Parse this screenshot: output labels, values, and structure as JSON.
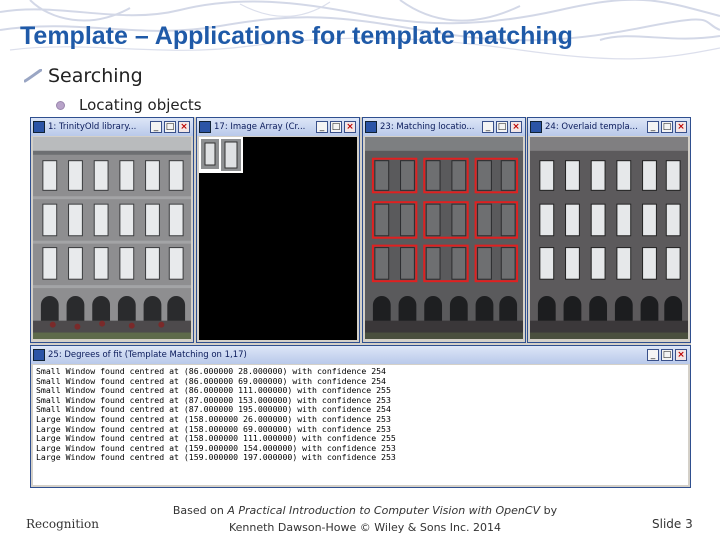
{
  "slide": {
    "title": "Template – Applications for template matching",
    "bullet_level1": "Searching",
    "bullet_level2": "Locating objects"
  },
  "windows": [
    {
      "title": "1: TrinityOld library...",
      "content": "original-image"
    },
    {
      "title": "17: Image Array (Cr...",
      "content": "template-array"
    },
    {
      "title": "23: Matching locatio...",
      "content": "matching-locations"
    },
    {
      "title": "24: Overlaid templa...",
      "content": "overlaid-templates"
    }
  ],
  "window_buttons": {
    "minimize": "_",
    "maximize": "□",
    "close": "×"
  },
  "output_window": {
    "title": "25: Degrees of fit (Template Matching on 1,17)",
    "lines": [
      "Small Window found centred at (86.000000 28.000000) with confidence 254",
      "Small Window found centred at (86.000000 69.000000) with confidence 254",
      "Small Window found centred at (86.000000 111.000000) with confidence 255",
      "Small Window found centred at (87.000000 153.000000) with confidence 253",
      "Small Window found centred at (87.000000 195.000000) with confidence 254",
      "Large Window found centred at (158.000000 26.000000) with confidence 253",
      "Large Window found centred at (158.000000 69.000000) with confidence 253",
      "Large Window found centred at (158.000000 111.000000) with confidence 255",
      "Large Window found centred at (159.000000 154.000000) with confidence 253",
      "Large Window found centred at (159.000000 197.000000) with confidence 253"
    ]
  },
  "footer": {
    "left": "Recognition",
    "center_prefix": "Based on",
    "center_italic": "A Practical Introduction to Computer Vision with OpenCV",
    "center_suffix": "by Kenneth Dawson-Howe © Wiley & Sons Inc. 2014",
    "right": "Slide 3"
  },
  "colors": {
    "title": "#1f5aa8",
    "match_box": "#e02020",
    "titlebar": "#c9d6f0"
  }
}
